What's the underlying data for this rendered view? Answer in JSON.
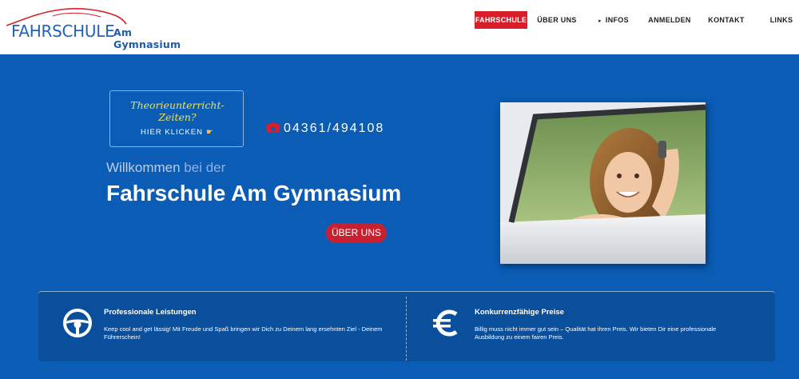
{
  "logo": {
    "main": "FAHRSCHULE",
    "sub": "Am Gymnasium",
    "icon": "car-outline-icon"
  },
  "nav": {
    "items": [
      {
        "label": "FAHRSCHULE",
        "active": true
      },
      {
        "label": "ÜBER UNS",
        "active": false
      },
      {
        "label": "INFOS",
        "active": false,
        "caret": "▸"
      },
      {
        "label": "ANMELDEN",
        "active": false
      },
      {
        "label": "KONTAKT",
        "active": false
      },
      {
        "label": "LINKS",
        "active": false
      }
    ]
  },
  "theory": {
    "title": "Theorieunterricht- Zeiten?",
    "link": "HIER KLICKEN",
    "icon": "pointing-hand-icon"
  },
  "phone": {
    "number": "04361/494108",
    "icon": "telephone-icon"
  },
  "hero": {
    "welcome_a": "Willkommen",
    "welcome_b": " bei der",
    "headline": "Fahrschule Am Gymnasium",
    "button": "ÜBER UNS",
    "photo": "young-woman-in-car-holding-keys"
  },
  "features": [
    {
      "icon": "steering-wheel-icon",
      "title": "Professionale Leistungen",
      "text": "Keep cool and get lässig! Mit Freude und Spaß bringen wir Dich zu Deinem lang ersehnten Ziel - Deinem Führerschein!"
    },
    {
      "icon": "euro-icon",
      "title": "Konkurrenzfähige Preise",
      "text": "Billig muss nicht immer gut sein – Qualität hat ihren Preis. Wir bieten Dir eine professionale Ausbildung zu einem fairen Preis."
    }
  ],
  "colors": {
    "brand_blue": "#0a5cb5",
    "panel_blue": "#0a4f9c",
    "accent_red": "#d81e2a",
    "button_red": "#c8202f"
  }
}
